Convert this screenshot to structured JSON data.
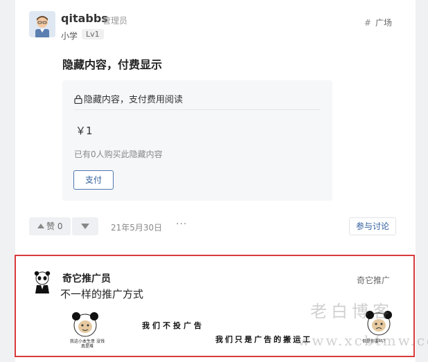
{
  "post": {
    "author": "qitabbs",
    "role": "管理员",
    "school": "小学",
    "level": "Lv1",
    "tag": "广场",
    "title": "隐藏内容，付费显示",
    "hidden": {
      "header": "隐藏内容，支付费用阅读",
      "price": "￥1",
      "bought": "已有0人购买此隐藏内容",
      "pay_label": "支付"
    },
    "actions": {
      "upvote_label": "赞 0",
      "date": "21年5月30日",
      "more": "···",
      "discuss_label": "参与讨论"
    }
  },
  "promo": {
    "name": "奇它推广员",
    "subtitle": "不一样的推广方式",
    "tag": "奇它推广",
    "banner": {
      "text1": "我们不投广告",
      "text2": "我们只是广告的搬运工",
      "caption_left": "我这小本生意 没钱真是难",
      "caption_right": "但是你要吗？"
    }
  },
  "watermark": {
    "line1": "老白博客",
    "line2": "www.xcbtmw.com"
  },
  "colors": {
    "accent": "#2e5d9c",
    "highlight_border": "#d93a3a"
  }
}
